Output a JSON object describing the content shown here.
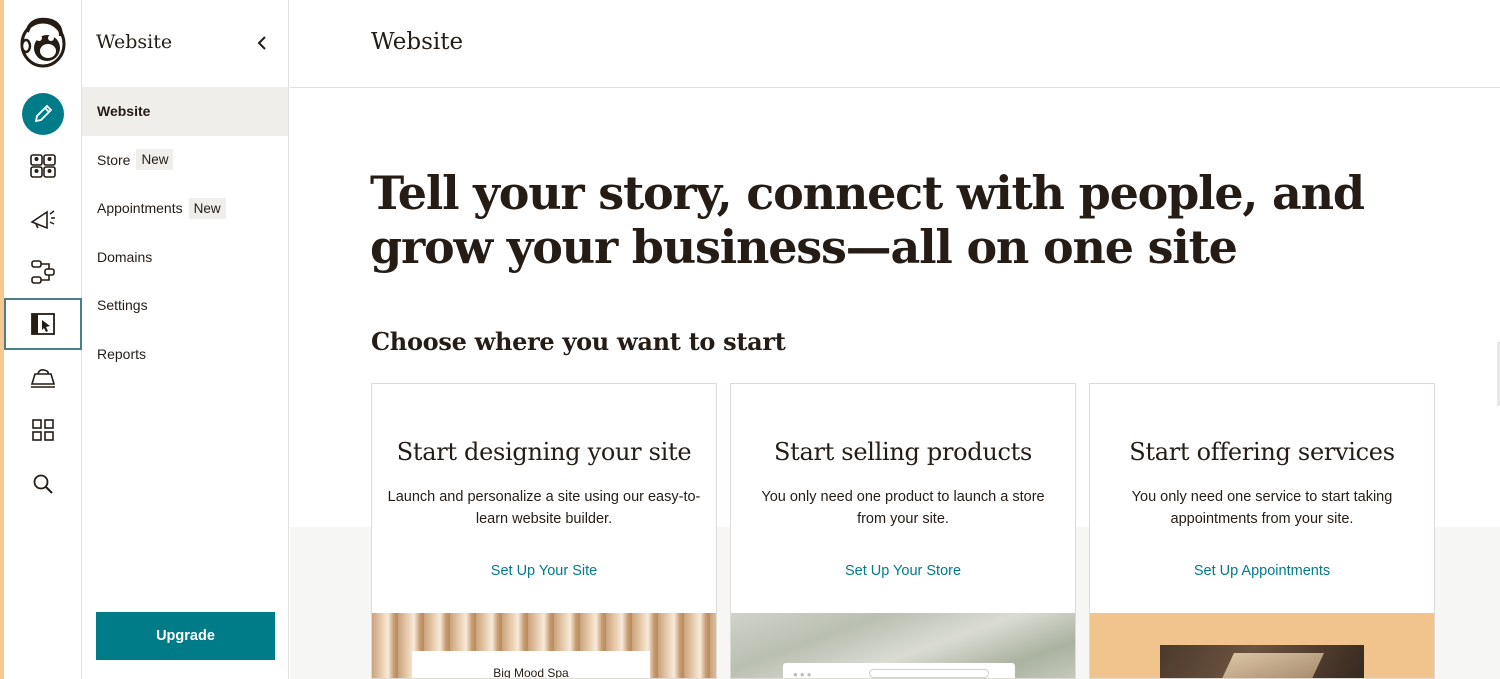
{
  "rail": {
    "items": [
      {
        "name": "create"
      },
      {
        "name": "audience"
      },
      {
        "name": "campaigns"
      },
      {
        "name": "automations"
      },
      {
        "name": "website"
      },
      {
        "name": "content"
      },
      {
        "name": "integrations"
      },
      {
        "name": "search"
      }
    ]
  },
  "subnav": {
    "title": "Website",
    "items": [
      {
        "label": "Website",
        "badge": ""
      },
      {
        "label": "Store",
        "badge": "New"
      },
      {
        "label": "Appointments",
        "badge": "New"
      },
      {
        "label": "Domains",
        "badge": ""
      },
      {
        "label": "Settings",
        "badge": ""
      },
      {
        "label": "Reports",
        "badge": ""
      }
    ],
    "upgrade_label": "Upgrade"
  },
  "main": {
    "title": "Website",
    "hero": "Tell your story, connect with people, and grow your business—all on one site",
    "subheading": "Choose where you want to start",
    "cards": [
      {
        "title": "Start designing your site",
        "description": "Launch and personalize a site using our easy-to-learn website builder.",
        "link": "Set Up Your Site",
        "image_text": "Big Mood Spa"
      },
      {
        "title": "Start selling products",
        "description": "You only need one product to launch a store from your site.",
        "link": "Set Up Your Store"
      },
      {
        "title": "Start offering services",
        "description": "You only need one service to start taking appointments from your site.",
        "link": "Set Up Appointments"
      }
    ]
  },
  "colors": {
    "accent": "#007c89",
    "strip": "#f4c88f",
    "text": "#241c15"
  }
}
